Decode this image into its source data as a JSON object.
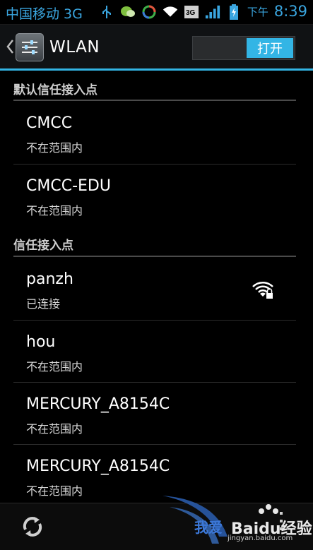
{
  "status_bar": {
    "carrier": "中国移动 3G",
    "ampm": "下午",
    "time": "8:39",
    "icons": [
      "usb-icon",
      "chat-icon",
      "sync-icon",
      "wifi-icon",
      "3g-icon",
      "signal-icon",
      "battery-icon"
    ]
  },
  "action_bar": {
    "title": "WLAN",
    "toggle_label": "打开",
    "accent_color": "#33b5e5"
  },
  "sections": [
    {
      "header": "默认信任接入点",
      "items": [
        {
          "name": "CMCC",
          "status": "不在范围内"
        },
        {
          "name": "CMCC-EDU",
          "status": "不在范围内"
        }
      ]
    },
    {
      "header": "信任接入点",
      "items": [
        {
          "name": "panzh",
          "status": "已连接",
          "icon": "wifi-lock-icon"
        },
        {
          "name": "hou",
          "status": "不在范围内"
        },
        {
          "name": "MERCURY_A8154C",
          "status": "不在范围内"
        },
        {
          "name": "MERCURY_A8154C",
          "status": "不在范围内"
        }
      ]
    }
  ],
  "bottom_bar": {
    "refresh_icon": "refresh-icon",
    "more_icon": "overflow-menu-icon"
  },
  "watermark": {
    "text": "我爱",
    "brand": "Baidu经验",
    "url": "jingyan.baidu.com"
  }
}
